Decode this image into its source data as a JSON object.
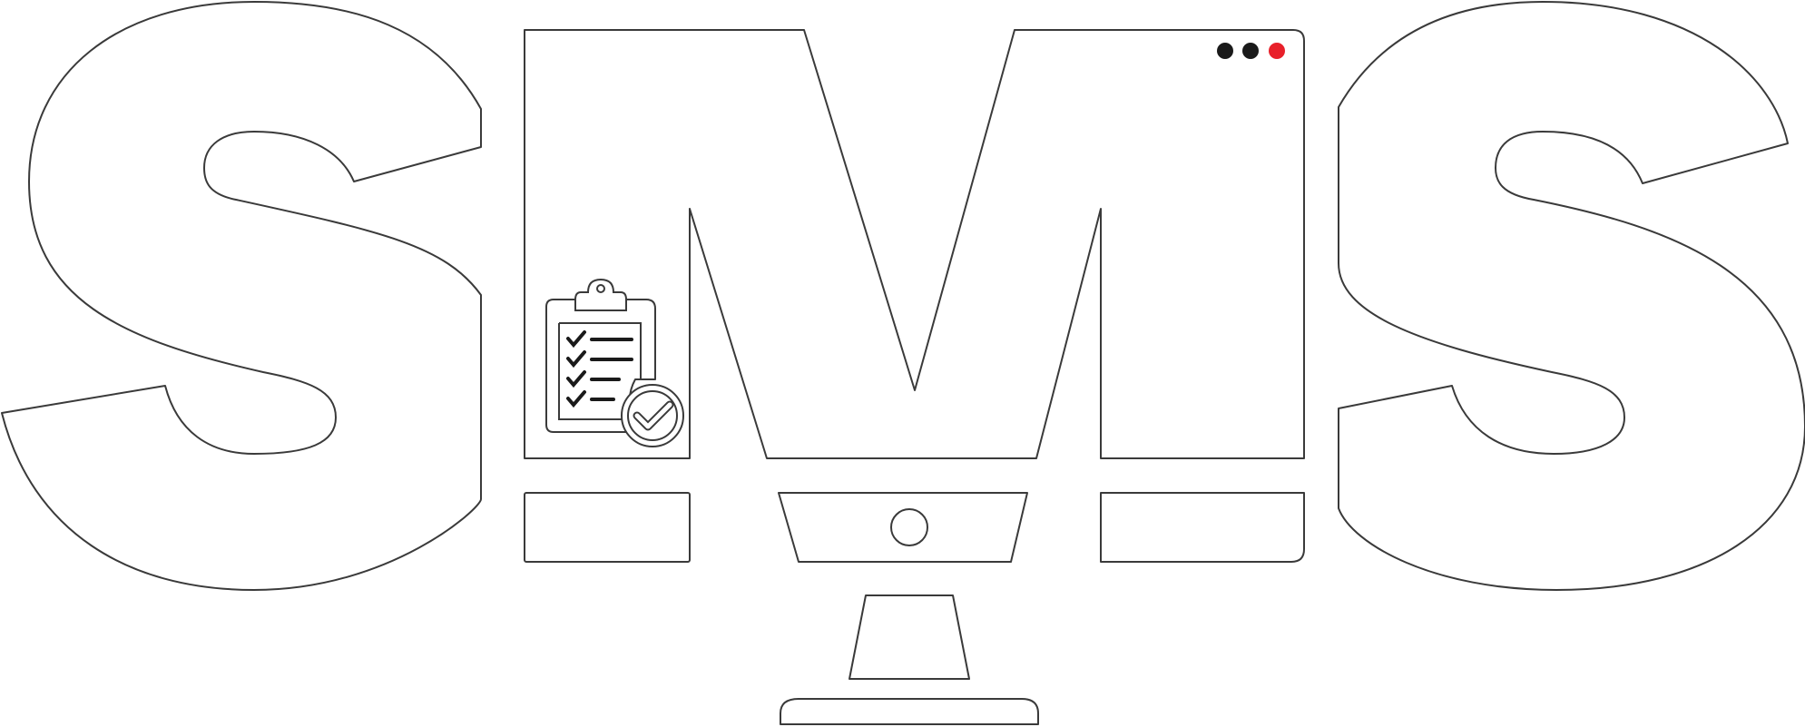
{
  "logo": {
    "text": "SMS",
    "colors": {
      "fill": "#ffffff",
      "outline": "#3a3a3a",
      "icon": "#1a1a1a",
      "dot_dark": "#1a1a1a",
      "dot_accent": "#e8202a"
    },
    "window_dots": [
      "dark",
      "dark",
      "red"
    ],
    "clipboard_items": 4,
    "icons": [
      "clipboard-checklist-icon",
      "check-circle-icon",
      "monitor-icon"
    ]
  }
}
